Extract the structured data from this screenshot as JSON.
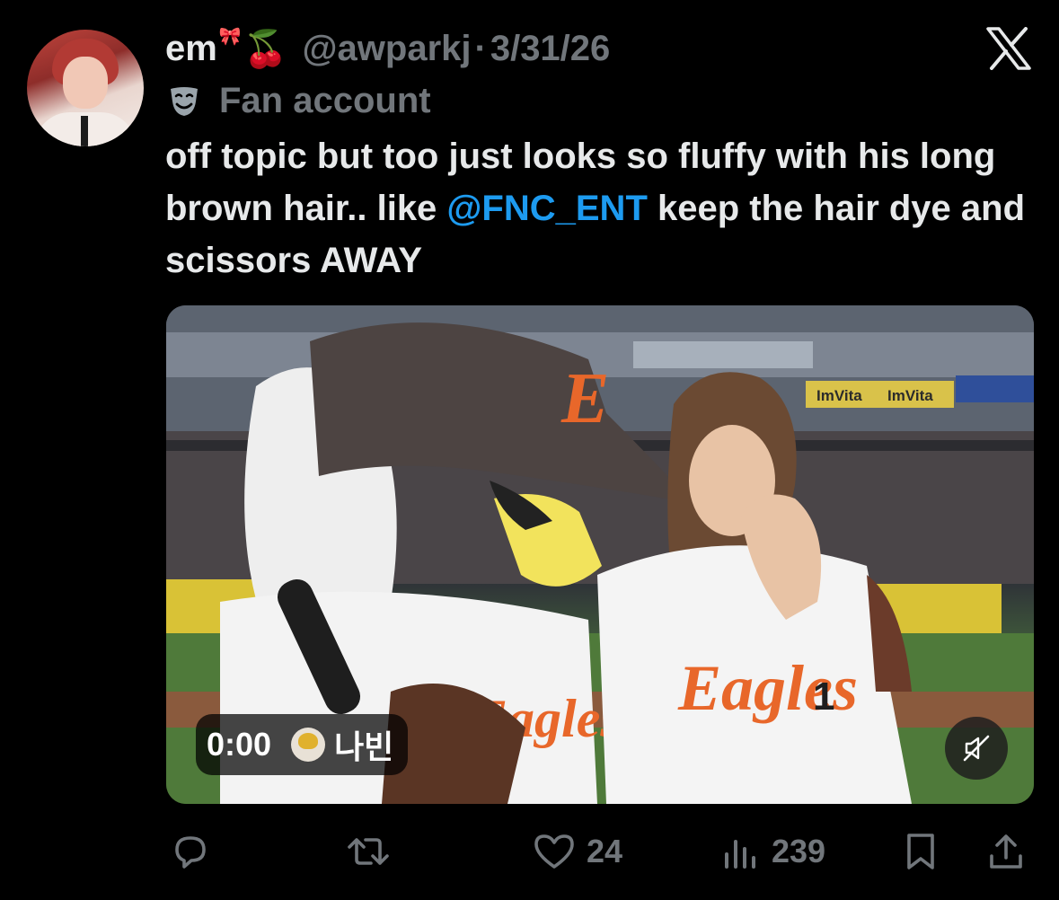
{
  "author": {
    "display_name": "em",
    "bow_glyph": "🎀",
    "cherry_glyph": "🍒",
    "handle": "@awparkj",
    "separator": "·",
    "date": "3/31/26",
    "label": "Fan account",
    "label_icon": "performing-arts-mask-icon"
  },
  "tweet": {
    "text_before": "off topic but too just looks so fluffy with his long brown hair.. like ",
    "mention": "@FNC_ENT",
    "text_after": " keep the hair dye and scissors AWAY"
  },
  "video": {
    "elapsed": "0:00",
    "source_name": "나빈",
    "mute_icon": "speaker-muted-icon",
    "stadium_sign_1": "ImVita",
    "stadium_sign_2": "ImVita",
    "mascot_cap_letter": "E",
    "jersey_text": "Eagles",
    "jersey_number": "1"
  },
  "actions": {
    "reply_icon": "reply-icon",
    "repost_icon": "repost-icon",
    "like_count": "24",
    "views_count": "239",
    "bookmark_icon": "bookmark-icon",
    "share_icon": "share-icon"
  },
  "colors": {
    "background": "#000000",
    "text": "#e7e9ea",
    "muted": "#71767b",
    "mention": "#1d9bf0"
  }
}
